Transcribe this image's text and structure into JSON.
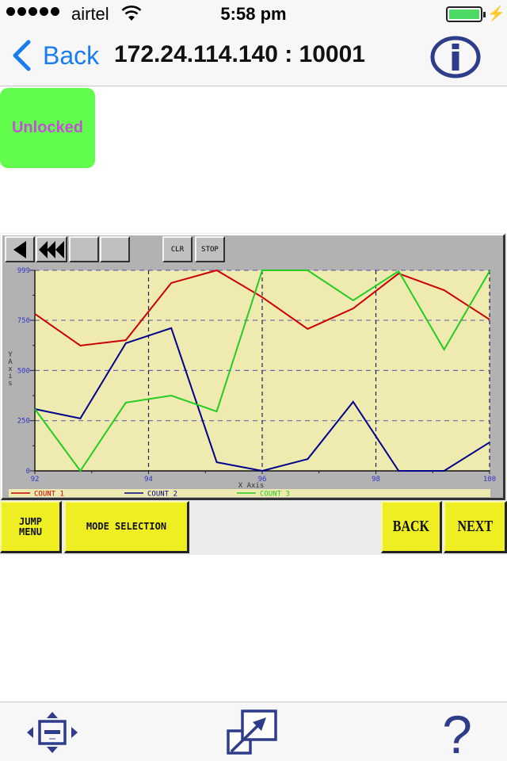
{
  "status_bar": {
    "signal_dots": 5,
    "carrier": "airtel",
    "time": "5:58 pm",
    "battery_percent": 100,
    "charging": true
  },
  "nav": {
    "back_label": "Back",
    "title": "172.24.114.140 : 10001",
    "info_icon": "info-icon",
    "accent_color": "#1a7cf2"
  },
  "lock_status": {
    "label": "Unlocked",
    "bg_color": "#62fc4d",
    "text_color": "#c44fd8"
  },
  "hmi": {
    "toolbar": {
      "prev_icon": "step-back-icon",
      "fast_back_icon": "fast-rewind-icon",
      "blank1": "",
      "blank2": "",
      "clr_label": "CLR",
      "stop_label": "STOP"
    },
    "buttons": {
      "jump_menu": "JUMP\nMENU",
      "jump_menu_line1": "JUMP",
      "jump_menu_line2": "MENU",
      "mode_selection": "MODE SELECTION",
      "back": "BACK",
      "next": "NEXT"
    }
  },
  "chart_data": {
    "type": "line",
    "title": "",
    "xlabel": "X Axis",
    "ylabel": "Y Axis",
    "xlim": [
      92,
      100
    ],
    "ylim": [
      0,
      999
    ],
    "x_ticks": [
      "92",
      "94",
      "96",
      "98",
      "100"
    ],
    "y_ticks": [
      "0",
      "250",
      "500",
      "750",
      "999"
    ],
    "grid": true,
    "legend_position": "bottom",
    "x": [
      92,
      92.8,
      93.6,
      94.4,
      95.2,
      96,
      96.8,
      97.6,
      98.4,
      99.2,
      100
    ],
    "series": [
      {
        "name": "COUNT 1",
        "color": "#cc0000",
        "values": [
          782,
          624,
          651,
          936,
          999,
          865,
          707,
          809,
          983,
          900,
          754
        ]
      },
      {
        "name": "COUNT 2",
        "color": "#00008b",
        "values": [
          308,
          261,
          636,
          711,
          43,
          0,
          59,
          344,
          0,
          0,
          142
        ]
      },
      {
        "name": "COUNT 3",
        "color": "#22cc22",
        "values": [
          308,
          0,
          340,
          375,
          296,
          999,
          999,
          849,
          995,
          604,
          995
        ]
      }
    ],
    "plot_bg": "#efebb0"
  },
  "bottom_toolbar": {
    "items": [
      "move-icon",
      "popout-icon",
      "help-icon"
    ]
  }
}
